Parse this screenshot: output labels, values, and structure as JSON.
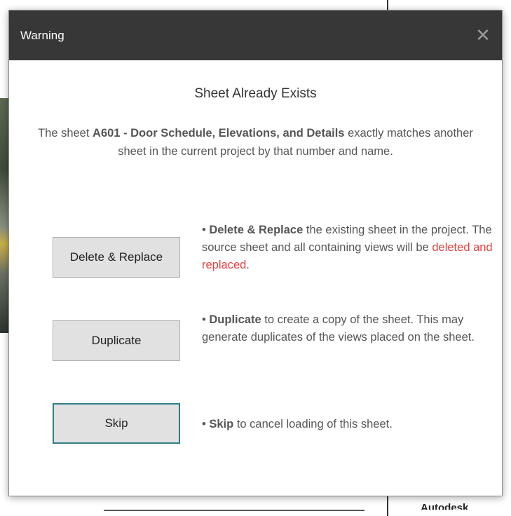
{
  "window": {
    "title": "Warning",
    "close_glyph": "✕"
  },
  "dialog": {
    "heading": "Sheet Already Exists",
    "message_prefix": "The sheet ",
    "sheet_name": "A601 - Door Schedule, Elevations, and Details",
    "message_suffix": " exactly matches another sheet in the current project by that number and name."
  },
  "options": [
    {
      "button_label": "Delete & Replace",
      "bullet": "• ",
      "bold": "Delete & Replace",
      "text": " the existing sheet in the project. The source sheet and all containing views will be ",
      "highlight": "deleted and replaced",
      "tail": "."
    },
    {
      "button_label": "Duplicate",
      "bullet": "• ",
      "bold": "Duplicate",
      "text": " to create a copy of the sheet. This may generate duplicates of the views placed on the sheet."
    },
    {
      "button_label": "Skip",
      "bullet": "• ",
      "bold": "Skip",
      "text": " to cancel loading of this sheet."
    }
  ],
  "background": {
    "brand_text": "Autodesk"
  },
  "colors": {
    "titlebar": "#373737",
    "highlight_red": "#e04343",
    "default_button_border": "#2f7f86"
  },
  "icons": {
    "close": "close-icon"
  }
}
